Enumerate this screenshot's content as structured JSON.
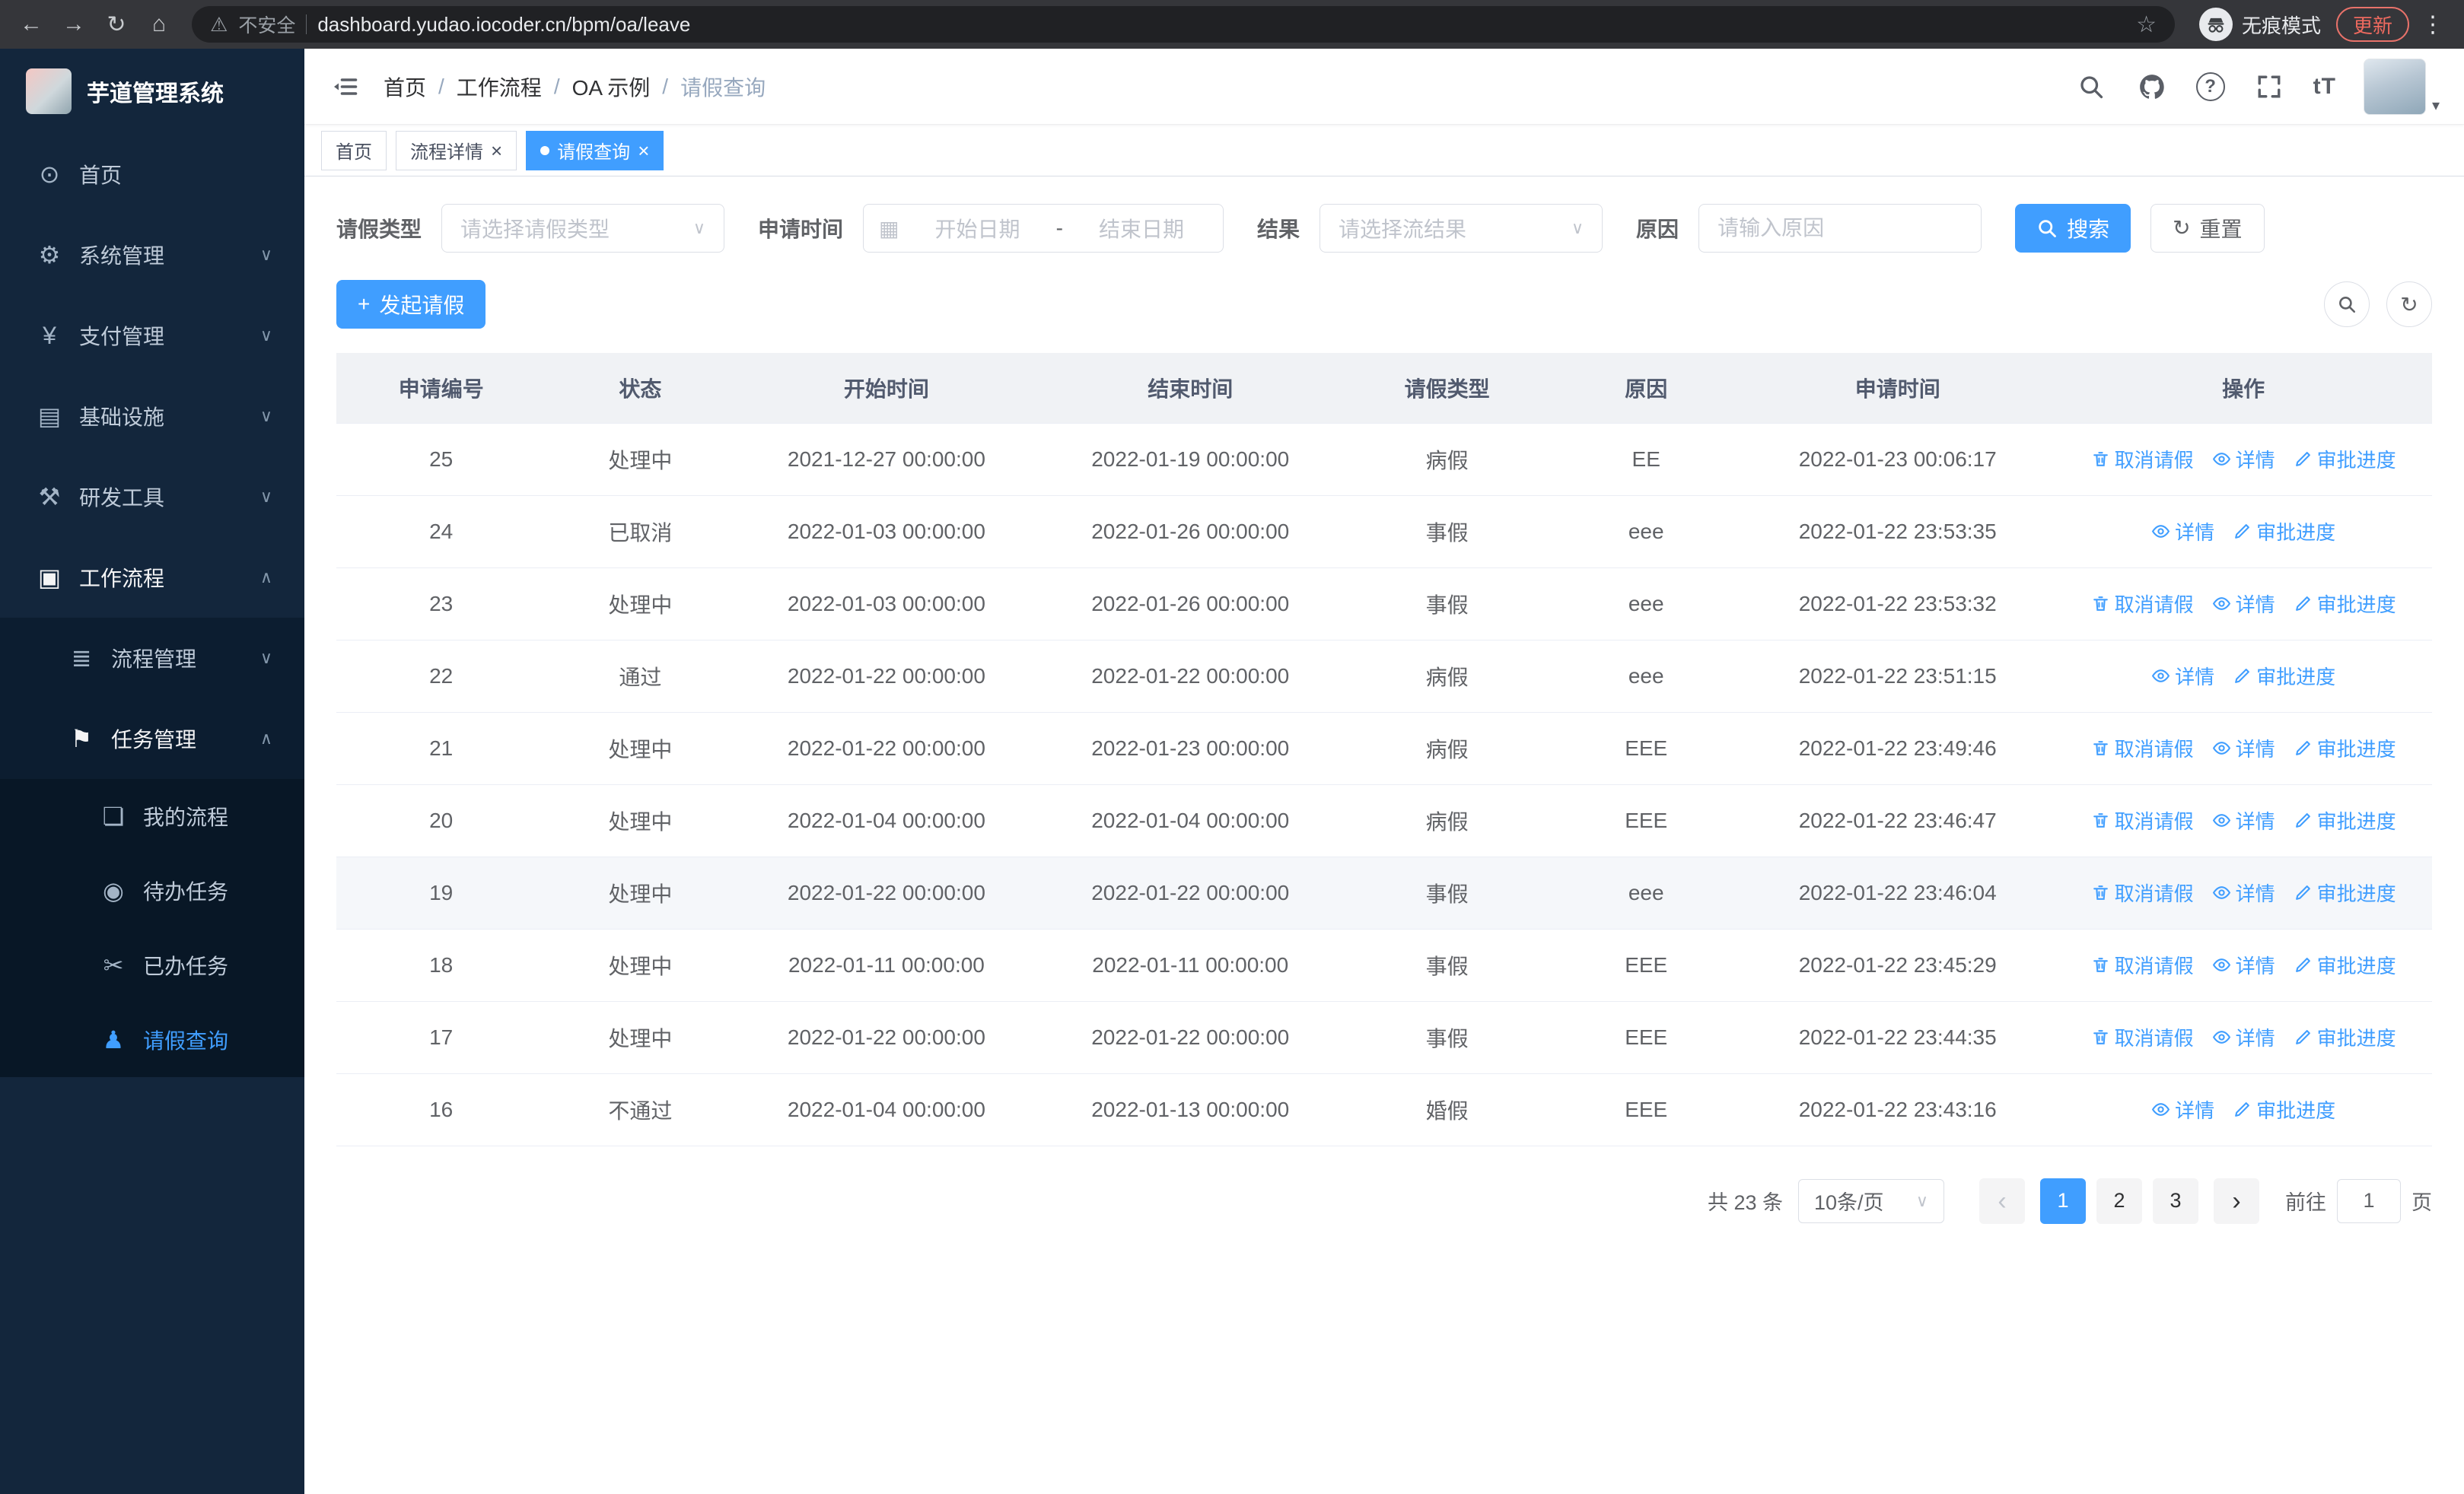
{
  "icons": {
    "back": "←",
    "forward": "→",
    "reload": "↻",
    "home": "⌂",
    "warning": "⚠",
    "star": "☆",
    "kebab": "⋮",
    "chevron_down": "∨",
    "chevron_up": "∧",
    "prev": "‹",
    "next": "›",
    "plus": "+",
    "calendar": "▦",
    "refresh": "↻",
    "text_size": "tT",
    "caret_small": "▾"
  },
  "browser": {
    "security_label": "不安全",
    "url": "dashboard.yudao.iocoder.cn/bpm/oa/leave",
    "incognito_label": "无痕模式",
    "update_label": "更新"
  },
  "sidebar": {
    "title": "芋道管理系统",
    "menu": [
      {
        "id": "home",
        "label": "首页",
        "icon": "dashboard-icon",
        "glyph": "⊙"
      },
      {
        "id": "system",
        "label": "系统管理",
        "icon": "gear-icon",
        "glyph": "⚙",
        "group": true
      },
      {
        "id": "payment",
        "label": "支付管理",
        "icon": "yen-icon",
        "glyph": "¥",
        "group": true
      },
      {
        "id": "infra",
        "label": "基础设施",
        "icon": "monitor-icon",
        "glyph": "▤",
        "group": true
      },
      {
        "id": "devtools",
        "label": "研发工具",
        "icon": "tools-icon",
        "glyph": "⚒",
        "group": true
      },
      {
        "id": "workflow",
        "label": "工作流程",
        "icon": "briefcase-icon",
        "glyph": "▣",
        "group": true,
        "expanded": true,
        "trail": true,
        "children": [
          {
            "id": "process-mgmt",
            "label": "流程管理",
            "icon": "list-icon",
            "glyph": "≣",
            "group": true
          },
          {
            "id": "task-mgmt",
            "label": "任务管理",
            "icon": "flag-icon",
            "glyph": "⚑",
            "group": true,
            "expanded": true,
            "trail": true,
            "children": [
              {
                "id": "my-process",
                "label": "我的流程",
                "icon": "comment-icon",
                "glyph": "❏"
              },
              {
                "id": "todo-tasks",
                "label": "待办任务",
                "icon": "eye-icon",
                "glyph": "◉"
              },
              {
                "id": "done-tasks",
                "label": "已办任务",
                "icon": "scissors-icon",
                "glyph": "✂"
              },
              {
                "id": "leave-query",
                "label": "请假查询",
                "icon": "user-icon",
                "glyph": "♟",
                "active": true
              }
            ]
          }
        ]
      }
    ]
  },
  "breadcrumb": {
    "items": [
      "首页",
      "工作流程",
      "OA 示例",
      "请假查询"
    ]
  },
  "tabs": {
    "items": [
      {
        "id": "home",
        "label": "首页"
      },
      {
        "id": "process-detail",
        "label": "流程详情",
        "closable": true
      },
      {
        "id": "leave-query",
        "label": "请假查询",
        "closable": true,
        "active": true
      }
    ]
  },
  "filters": {
    "leave_type_label": "请假类型",
    "leave_type_placeholder": "请选择请假类型",
    "apply_time_label": "申请时间",
    "start_date_placeholder": "开始日期",
    "range_separator": "-",
    "end_date_placeholder": "结束日期",
    "result_label": "结果",
    "result_placeholder": "请选择流结果",
    "reason_label": "原因",
    "reason_placeholder": "请输入原因",
    "search_label": "搜索",
    "reset_label": "重置"
  },
  "toolbar": {
    "create_label": "发起请假"
  },
  "table": {
    "headers": [
      "申请编号",
      "状态",
      "开始时间",
      "结束时间",
      "请假类型",
      "原因",
      "申请时间",
      "操作"
    ],
    "action_labels": {
      "cancel": "取消请假",
      "detail": "详情",
      "progress": "审批进度"
    },
    "rows": [
      {
        "id": "25",
        "status": "处理中",
        "start": "2021-12-27 00:00:00",
        "end": "2022-01-19 00:00:00",
        "type": "病假",
        "reason": "EE",
        "applied": "2022-01-23 00:06:17",
        "actions": [
          "cancel",
          "detail",
          "progress"
        ]
      },
      {
        "id": "24",
        "status": "已取消",
        "start": "2022-01-03 00:00:00",
        "end": "2022-01-26 00:00:00",
        "type": "事假",
        "reason": "eee",
        "applied": "2022-01-22 23:53:35",
        "actions": [
          "detail",
          "progress"
        ]
      },
      {
        "id": "23",
        "status": "处理中",
        "start": "2022-01-03 00:00:00",
        "end": "2022-01-26 00:00:00",
        "type": "事假",
        "reason": "eee",
        "applied": "2022-01-22 23:53:32",
        "actions": [
          "cancel",
          "detail",
          "progress"
        ]
      },
      {
        "id": "22",
        "status": "通过",
        "start": "2022-01-22 00:00:00",
        "end": "2022-01-22 00:00:00",
        "type": "病假",
        "reason": "eee",
        "applied": "2022-01-22 23:51:15",
        "actions": [
          "detail",
          "progress"
        ]
      },
      {
        "id": "21",
        "status": "处理中",
        "start": "2022-01-22 00:00:00",
        "end": "2022-01-23 00:00:00",
        "type": "病假",
        "reason": "EEE",
        "applied": "2022-01-22 23:49:46",
        "actions": [
          "cancel",
          "detail",
          "progress"
        ]
      },
      {
        "id": "20",
        "status": "处理中",
        "start": "2022-01-04 00:00:00",
        "end": "2022-01-04 00:00:00",
        "type": "病假",
        "reason": "EEE",
        "applied": "2022-01-22 23:46:47",
        "actions": [
          "cancel",
          "detail",
          "progress"
        ]
      },
      {
        "id": "19",
        "status": "处理中",
        "start": "2022-01-22 00:00:00",
        "end": "2022-01-22 00:00:00",
        "type": "事假",
        "reason": "eee",
        "applied": "2022-01-22 23:46:04",
        "actions": [
          "cancel",
          "detail",
          "progress"
        ],
        "hovered": true
      },
      {
        "id": "18",
        "status": "处理中",
        "start": "2022-01-11 00:00:00",
        "end": "2022-01-11 00:00:00",
        "type": "事假",
        "reason": "EEE",
        "applied": "2022-01-22 23:45:29",
        "actions": [
          "cancel",
          "detail",
          "progress"
        ]
      },
      {
        "id": "17",
        "status": "处理中",
        "start": "2022-01-22 00:00:00",
        "end": "2022-01-22 00:00:00",
        "type": "事假",
        "reason": "EEE",
        "applied": "2022-01-22 23:44:35",
        "actions": [
          "cancel",
          "detail",
          "progress"
        ]
      },
      {
        "id": "16",
        "status": "不通过",
        "start": "2022-01-04 00:00:00",
        "end": "2022-01-13 00:00:00",
        "type": "婚假",
        "reason": "EEE",
        "applied": "2022-01-22 23:43:16",
        "actions": [
          "detail",
          "progress"
        ]
      }
    ]
  },
  "pagination": {
    "total_label": "共 23 条",
    "page_size_label": "10条/页",
    "pages": [
      "1",
      "2",
      "3"
    ],
    "active_page": "1",
    "goto_prefix": "前往",
    "goto_value": "1",
    "goto_suffix": "页"
  }
}
